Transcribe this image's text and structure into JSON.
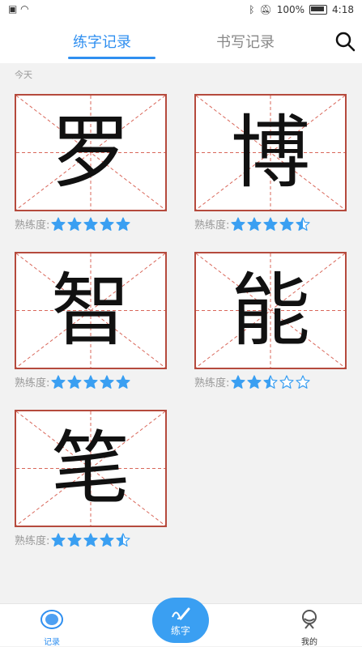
{
  "status": {
    "time": "4:18",
    "battery": "100%"
  },
  "tabs": [
    {
      "label": "练字记录",
      "active": true
    },
    {
      "label": "书写记录",
      "active": false
    }
  ],
  "section": "今天",
  "proficiency_label": "熟练度:",
  "cards": [
    {
      "char": "罗",
      "stars": 5
    },
    {
      "char": "博",
      "stars": 4.5
    },
    {
      "char": "智",
      "stars": 5
    },
    {
      "char": "能",
      "stars": 2.5
    },
    {
      "char": "笔",
      "stars": 4.5
    }
  ],
  "nav": {
    "records": "记录",
    "practice": "练字",
    "me": "我的"
  },
  "colors": {
    "accent": "#2f8ff0",
    "grid_border": "#b54a3d",
    "star": "#3a9ff2"
  }
}
